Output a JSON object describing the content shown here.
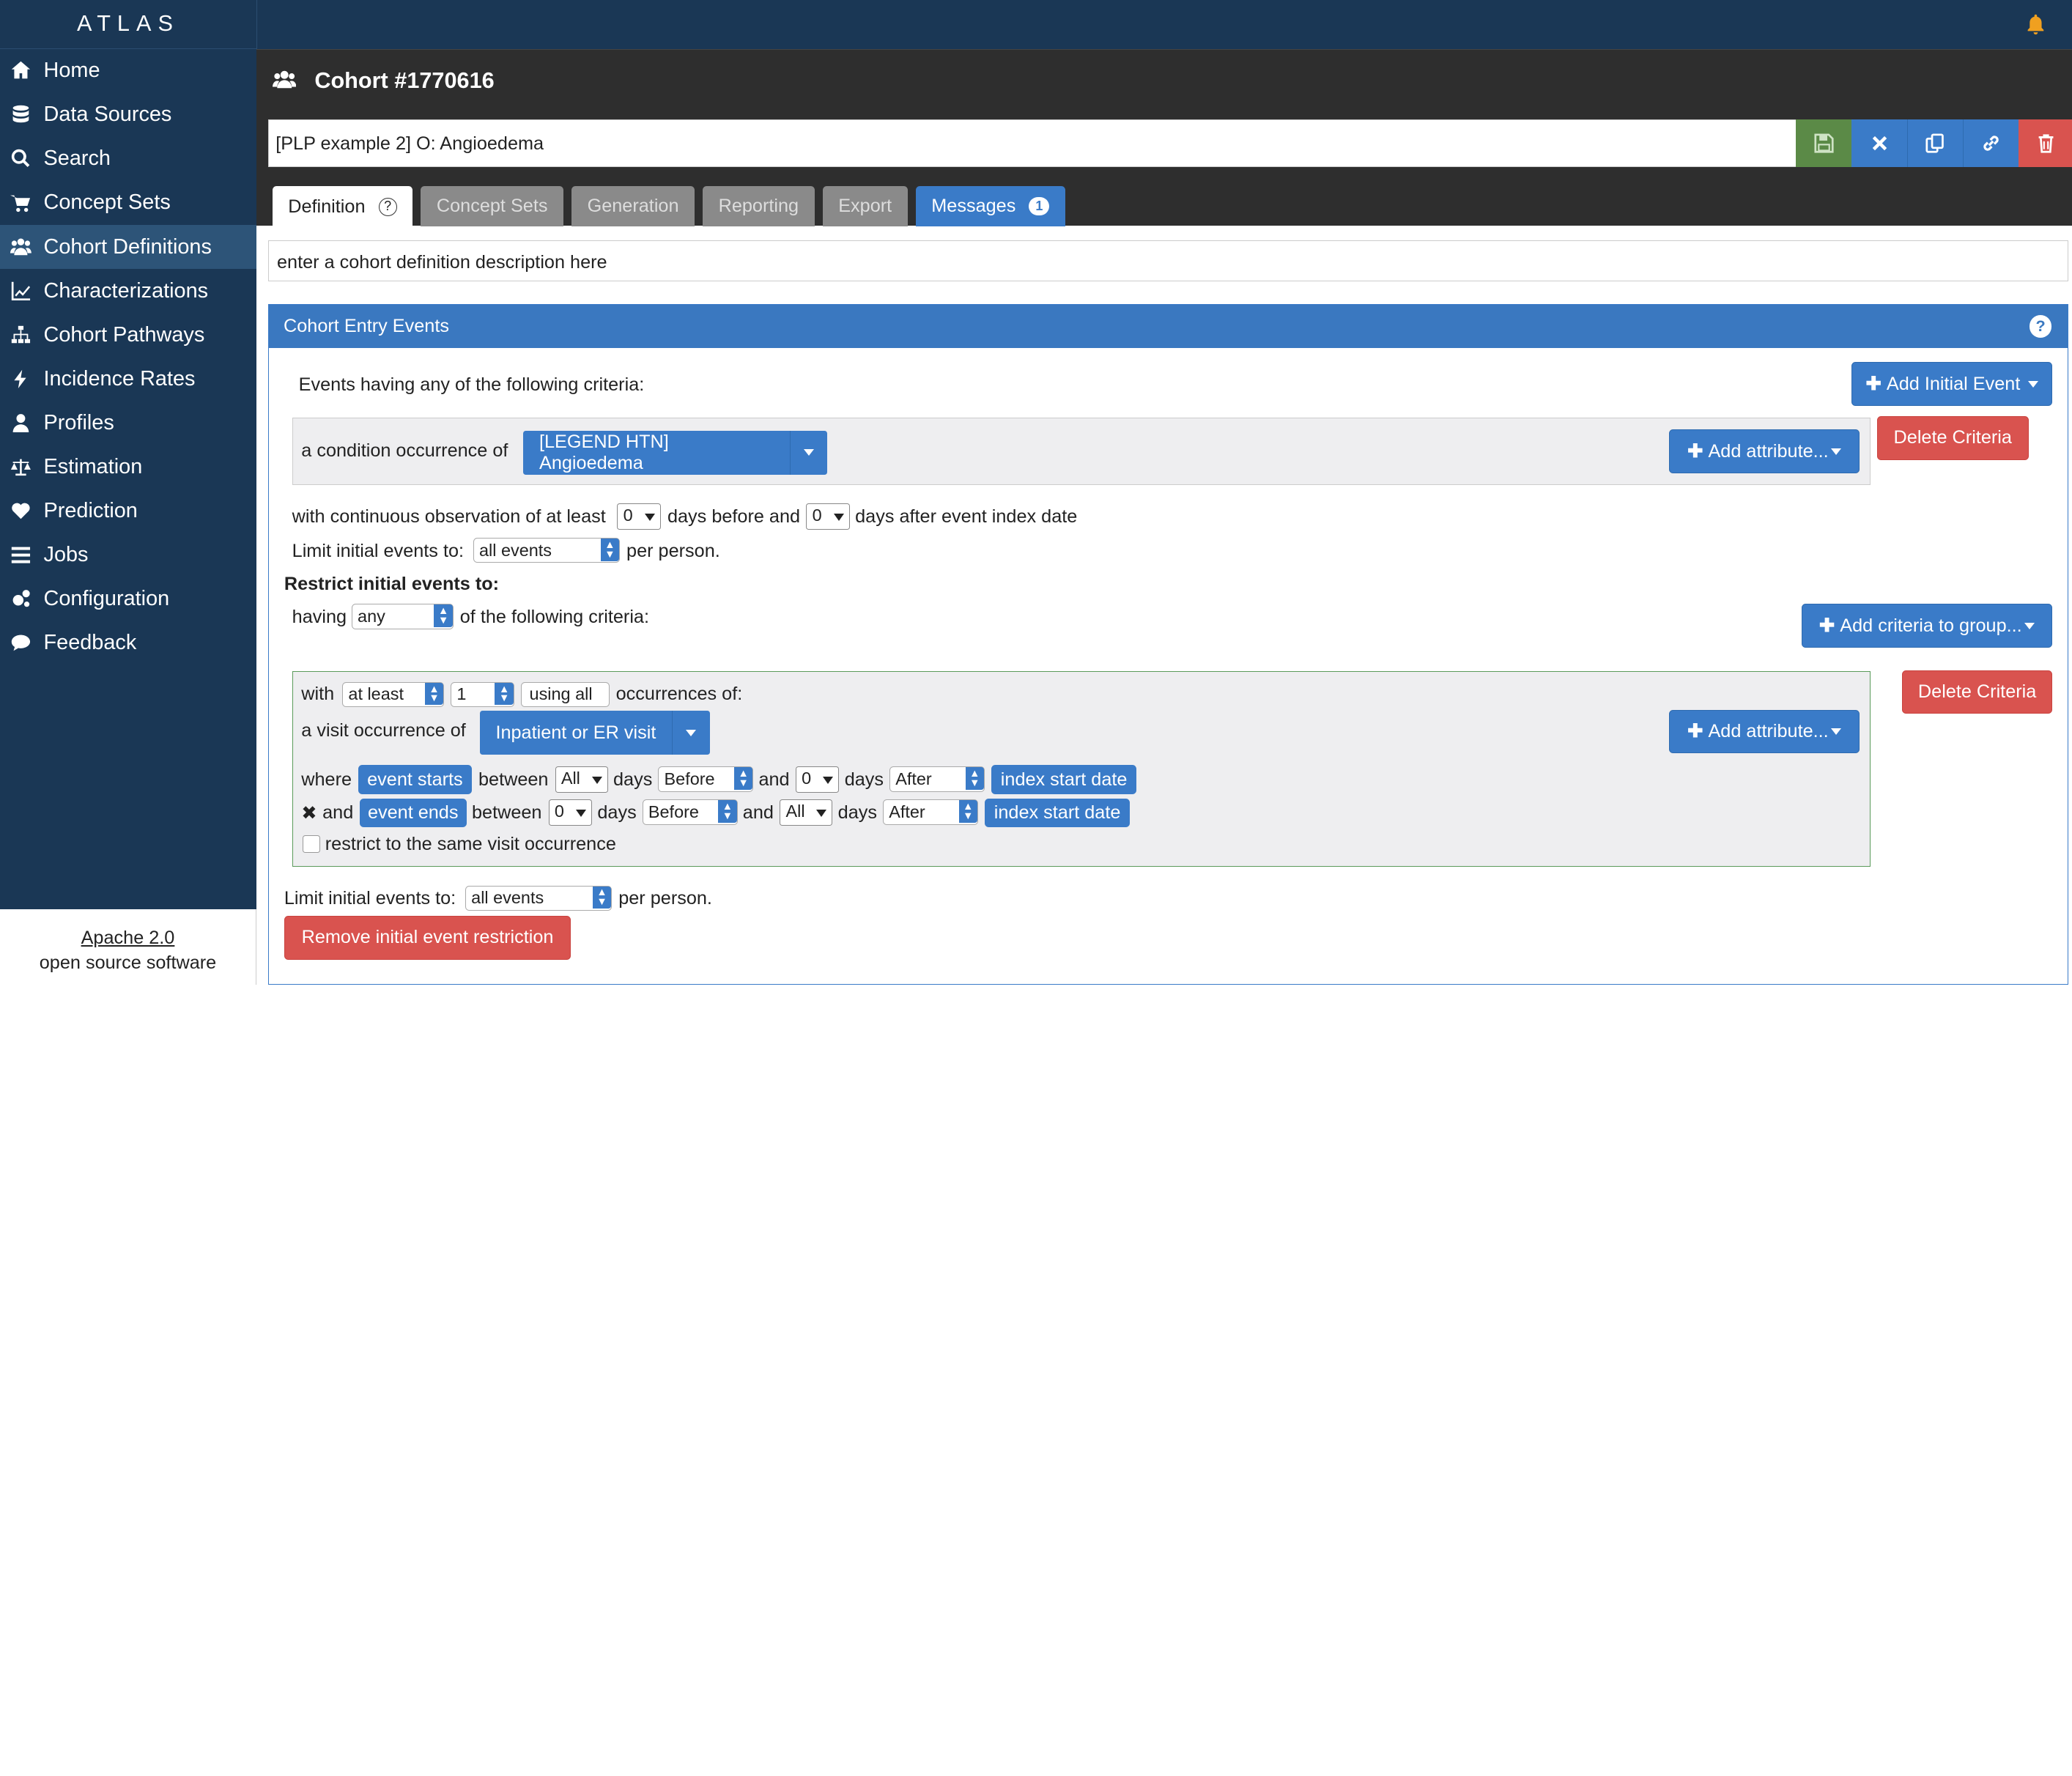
{
  "app": {
    "brand": "ATLAS"
  },
  "sidebar": {
    "items": [
      {
        "label": "Home",
        "icon": "home-icon"
      },
      {
        "label": "Data Sources",
        "icon": "database-icon"
      },
      {
        "label": "Search",
        "icon": "search-icon"
      },
      {
        "label": "Concept Sets",
        "icon": "cart-icon"
      },
      {
        "label": "Cohort Definitions",
        "icon": "users-icon",
        "active": true
      },
      {
        "label": "Characterizations",
        "icon": "line-chart-icon"
      },
      {
        "label": "Cohort Pathways",
        "icon": "sitemap-icon"
      },
      {
        "label": "Incidence Rates",
        "icon": "bolt-icon"
      },
      {
        "label": "Profiles",
        "icon": "user-icon"
      },
      {
        "label": "Estimation",
        "icon": "balance-scale-icon"
      },
      {
        "label": "Prediction",
        "icon": "heartbeat-icon"
      },
      {
        "label": "Jobs",
        "icon": "list-icon"
      },
      {
        "label": "Configuration",
        "icon": "cogs-icon"
      },
      {
        "label": "Feedback",
        "icon": "comment-icon"
      }
    ],
    "footer": {
      "license": "Apache 2.0",
      "tagline": "open source software"
    }
  },
  "header": {
    "title": "Cohort #1770616",
    "name_value": "[PLP example 2] O: Angioedema",
    "toolbar_icons": [
      "save-icon",
      "close-icon",
      "copy-icon",
      "link-icon",
      "trash-icon"
    ],
    "colors": {
      "save": "#5b8a47",
      "blue": "#3a7bc8",
      "red": "#d9534f"
    }
  },
  "tabs": [
    {
      "label": "Definition",
      "active": true
    },
    {
      "label": "Concept Sets"
    },
    {
      "label": "Generation"
    },
    {
      "label": "Reporting"
    },
    {
      "label": "Export"
    },
    {
      "label": "Messages",
      "badge": "1"
    }
  ],
  "description_placeholder": "enter a cohort definition description here",
  "panel": {
    "title": "Cohort Entry Events",
    "help": "?",
    "events_heading": "Events having any of the following criteria:",
    "add_initial_event": "Add Initial Event",
    "criteria1": {
      "prefix": "a condition occurrence of",
      "concept": "[LEGEND HTN] Angioedema",
      "add_attribute": "Add attribute...",
      "delete": "Delete Criteria"
    },
    "observation": {
      "text1": "with continuous observation of at least",
      "before_val": "0",
      "text2": "days before and",
      "after_val": "0",
      "text3": "days after event index date"
    },
    "limit1": {
      "label": "Limit initial events to:",
      "value": "all events",
      "suffix": "per person."
    },
    "restrict_heading": "Restrict initial events to:",
    "having": {
      "label": "having",
      "value": "any",
      "suffix": "of the following criteria:"
    },
    "add_criteria_group": "Add criteria to group...",
    "group": {
      "with": "with",
      "count_type": "at least",
      "count": "1",
      "using": "using all",
      "occ_of": "occurrences of:",
      "visit_prefix": "a visit occurrence of",
      "visit_concept": "Inpatient or ER visit",
      "add_attribute": "Add attribute...",
      "delete": "Delete Criteria",
      "row1": {
        "where": "where",
        "event": "event starts",
        "between": "between",
        "v1": "All",
        "days1": "days",
        "rel1": "Before",
        "and": "and",
        "v2": "0",
        "days2": "days",
        "rel2": "After",
        "index": "index start date"
      },
      "row2": {
        "x": "✖",
        "and_label": "and",
        "event": "event ends",
        "between": "between",
        "v1": "0",
        "days1": "days",
        "rel1": "Before",
        "and": "and",
        "v2": "All",
        "days2": "days",
        "rel2": "After",
        "index": "index start date"
      },
      "restrict_visit": "restrict to the same visit occurrence"
    },
    "limit2": {
      "label": "Limit initial events to:",
      "value": "all events",
      "suffix": "per person."
    },
    "remove_restriction": "Remove initial event restriction"
  }
}
